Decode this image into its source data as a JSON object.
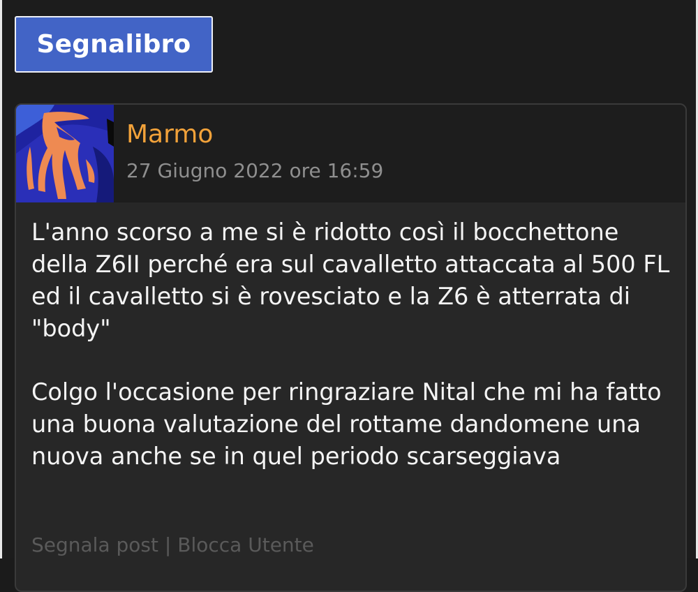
{
  "toolbar": {
    "bookmark_label": "Segnalibro"
  },
  "post": {
    "author": "Marmo",
    "date": "27 Giugno 2022 ore 16:59",
    "paragraphs": [
      "L'anno scorso a me si è ridotto così il bocchettone della Z6II perché era sul cavalletto attaccata al 500 FL ed il cavalletto si è rovesciato e la Z6 è atterrata di \"body\"",
      "Colgo l'occasione per ringraziare Nital che mi ha fatto una buona valutazione del rottame dandomene una nuova anche se in quel periodo scarseggiava"
    ],
    "actions": {
      "report": "Segnala post",
      "separator": "|",
      "block": "Blocca Utente"
    }
  },
  "colors": {
    "accent_button": "#4264c6",
    "author_name": "#f2a23a",
    "muted_text": "#8f8f8f",
    "card_background": "#272727"
  }
}
